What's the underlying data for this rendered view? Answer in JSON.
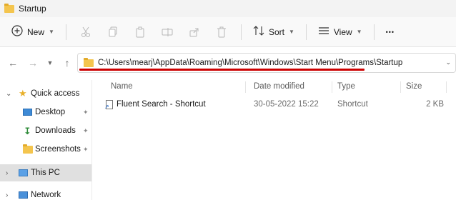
{
  "window": {
    "title": "Startup"
  },
  "toolbar": {
    "new_label": "New",
    "sort_label": "Sort",
    "view_label": "View",
    "more_label": "•••"
  },
  "address": {
    "path": "C:\\Users\\mearj\\AppData\\Roaming\\Microsoft\\Windows\\Start Menu\\Programs\\Startup"
  },
  "sidebar": {
    "items": [
      {
        "label": "Quick access"
      },
      {
        "label": "Desktop"
      },
      {
        "label": "Downloads"
      },
      {
        "label": "Screenshots"
      },
      {
        "label": "This PC"
      },
      {
        "label": "Network"
      }
    ]
  },
  "columns": {
    "name": "Name",
    "date": "Date modified",
    "type": "Type",
    "size": "Size"
  },
  "files": [
    {
      "name": "Fluent Search - Shortcut",
      "date": "30-05-2022 15:22",
      "type": "Shortcut",
      "size": "2 KB"
    }
  ],
  "colors": {
    "accent_underline": "#cc0000",
    "selected_bg": "#e0e0e0",
    "folder": "#f4c54e"
  }
}
